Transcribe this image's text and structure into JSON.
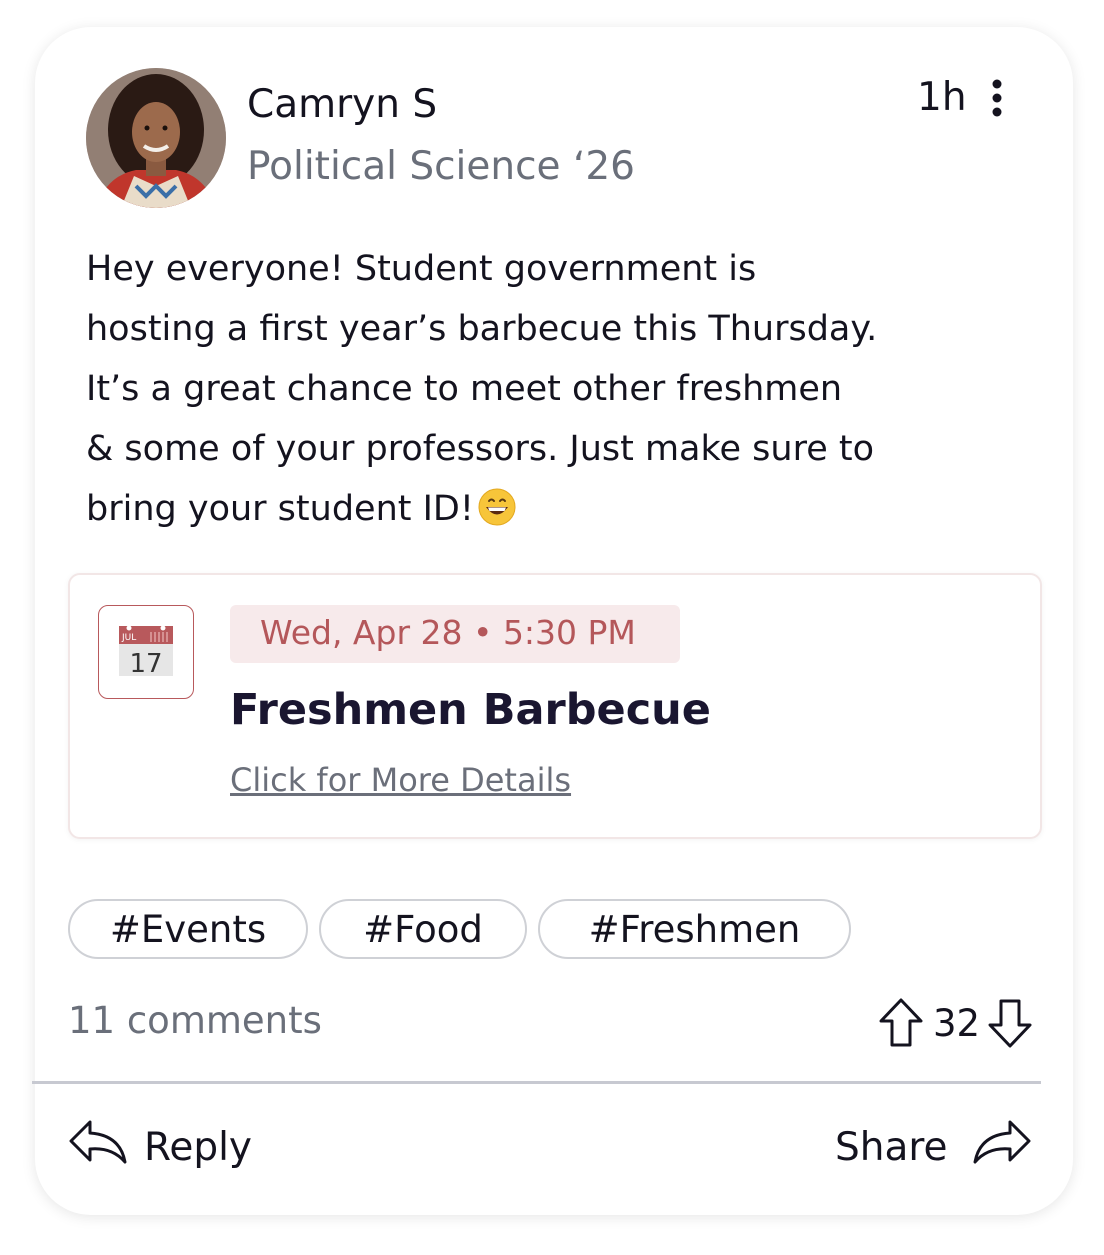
{
  "post": {
    "author_name": "Camryn S",
    "author_subtitle": "Political Science ‘26",
    "time": "1h",
    "menu_icon": "more-vertical-icon",
    "body": "Hey everyone! Student government is\nhosting a first year’s barbecue this Thursday.\nIt’s a great chance to meet other freshmen\n& some of your professors. Just make sure to\nbring your student ID!",
    "emoji": "grinning-face-emoji"
  },
  "event": {
    "calendar_icon": "calendar-icon",
    "calendar_month": "JUL",
    "calendar_day": "17",
    "date": "Wed, Apr 28 • 5:30 PM",
    "title": "Freshmen Barbecue",
    "link": "Click for More Details"
  },
  "tags": [
    "#Events",
    "#Food",
    "#Freshmen"
  ],
  "stats": {
    "comments": "11 comments",
    "votes": "32"
  },
  "actions": {
    "reply_label": "Reply",
    "share_label": "Share"
  },
  "colors": {
    "accent": "#b4575a",
    "accent_bg": "#f7eaeb",
    "text": "#14131f",
    "muted": "#6a6f7a",
    "border": "#cfd1d6"
  }
}
